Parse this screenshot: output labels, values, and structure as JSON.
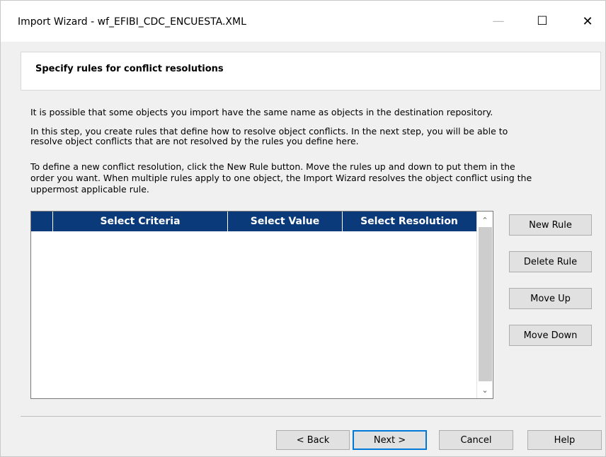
{
  "window": {
    "title": "Import Wizard - wf_EFIBI_CDC_ENCUESTA.XML",
    "minimize_glyph": "—",
    "maximize_glyph": "☐",
    "close_glyph": "✕"
  },
  "header": {
    "title": "Specify rules for conflict resolutions"
  },
  "description": {
    "p1": "It is possible that some objects you import have the same name as objects in the destination repository.",
    "p2_line1": "In this step, you create rules that define how to resolve object conflicts. In the next step, you will be able to",
    "p2_line2": "resolve object conflicts that are not resolved by the rules you define here.",
    "p3_line1": "To define a new conflict resolution, click the New Rule button. Move the rules up and down to put them in the",
    "p3_line2": "order you want. When multiple rules apply to one object, the Import Wizard resolves the object conflict using the",
    "p3_line3": "uppermost applicable rule."
  },
  "rules_grid": {
    "columns": [
      "Select Criteria",
      "Select Value",
      "Select Resolution"
    ],
    "rows": [],
    "scroll_up_glyph": "⌃",
    "scroll_down_glyph": "⌄"
  },
  "side_buttons": {
    "new_rule": "New Rule",
    "delete_rule": "Delete Rule",
    "move_up": "Move Up",
    "move_down": "Move Down"
  },
  "footer_buttons": {
    "back": "< Back",
    "next": "Next >",
    "cancel": "Cancel",
    "help": "Help"
  }
}
